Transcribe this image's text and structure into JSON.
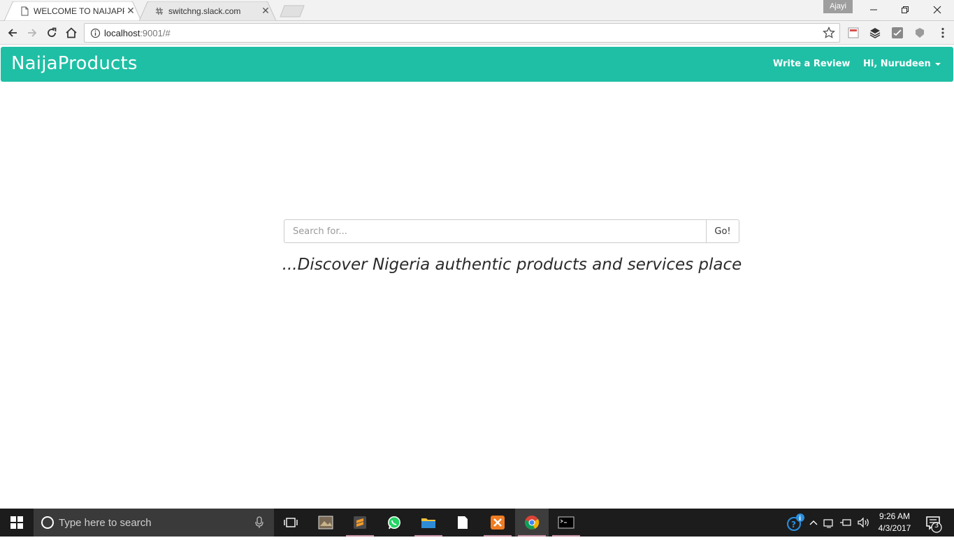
{
  "browser": {
    "tabs": [
      {
        "title": "WELCOME TO NAIJAPRO",
        "favicon": "page-icon",
        "active": true
      },
      {
        "title": "switchng.slack.com",
        "favicon": "slack-icon",
        "active": false
      }
    ],
    "profile_name": "Ajayi",
    "address": {
      "host": "localhost",
      "path": ":9001/#"
    }
  },
  "navbar": {
    "brand": "NaijaProducts",
    "links": {
      "review": "Write a Review",
      "user": "Hi, Nurudeen"
    },
    "color": "#1fbfa5"
  },
  "search": {
    "placeholder": "Search for...",
    "value": "",
    "button_label": "Go!"
  },
  "tagline": "...Discover Nigeria authentic products and services place",
  "taskbar": {
    "search_placeholder": "Type here to search",
    "apps": [
      "task-view-icon",
      "photo-app-icon",
      "sublime-text-icon",
      "whatsapp-icon",
      "file-explorer-icon",
      "document-icon",
      "xampp-icon",
      "chrome-icon",
      "terminal-icon"
    ],
    "clock_time": "9:26 AM",
    "clock_date": "4/3/2017",
    "notification_count": "3"
  }
}
